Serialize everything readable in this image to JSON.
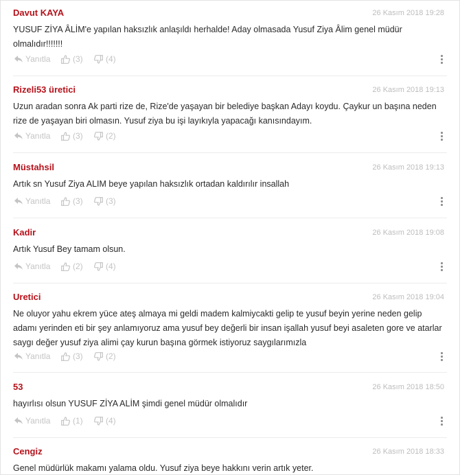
{
  "labels": {
    "reply": "Yanıtla"
  },
  "comments": [
    {
      "author": "Davut KAYA",
      "date": "26 Kasım 2018 19:28",
      "lines": [
        "YUSUF ZİYA ÂLİM'e yapılan haksızlık anlaşıldı herhalde! Aday olmasada Yusuf Ziya Âlim genel müdür",
        "olmalıdır!!!!!!!"
      ],
      "likes": "(3)",
      "dislikes": "(4)"
    },
    {
      "author": "Rizeli53 üretici",
      "date": "26 Kasım 2018 19:13",
      "lines": [
        "Uzun aradan sonra Ak parti rize de, Rize'de yaşayan bir belediye başkan Adayı koydu. Çaykur un başına neden",
        "rize de yaşayan biri olmasın. Yusuf ziya bu işi layıkıyla yapacağı kanısındayım."
      ],
      "likes": "(3)",
      "dislikes": "(2)"
    },
    {
      "author": "Müstahsil",
      "date": "26 Kasım 2018 19:13",
      "lines": [
        "Artık sn Yusuf Ziya ALIM beye yapılan haksızlık ortadan kaldırılır insallah"
      ],
      "likes": "(3)",
      "dislikes": "(3)"
    },
    {
      "author": "Kadir",
      "date": "26 Kasım 2018 19:08",
      "lines": [
        "Artık Yusuf Bey tamam olsun."
      ],
      "likes": "(2)",
      "dislikes": "(4)"
    },
    {
      "author": "Uretici",
      "date": "26 Kasım 2018 19:04",
      "lines": [
        "Ne oluyor yahu ekrem yüce ateş almaya mi geldi madem kalmiycakti gelip te yusuf beyin yerine neden gelip",
        "adamı yerinden eti bir şey anlamıyoruz ama yusuf bey değerli bir insan işallah yusuf beyi asaleten gore ve atarlar",
        "saygı değer yusuf ziya alimi çay kurun başına görmek istiyoruz saygılarımızla"
      ],
      "likes": "(3)",
      "dislikes": "(2)"
    },
    {
      "author": "53",
      "date": "26 Kasım 2018 18:50",
      "lines": [
        "hayırlısı olsun YUSUF ZİYA ALİM şimdi genel müdür olmalıdır"
      ],
      "likes": "(1)",
      "dislikes": "(4)"
    },
    {
      "author": "Cengiz",
      "date": "26 Kasım 2018 18:33",
      "lines": [
        "Genel müdürlük makamı yalama oldu. Yusuf ziya beye hakkını verin artık yeter."
      ],
      "likes": "",
      "dislikes": ""
    }
  ]
}
